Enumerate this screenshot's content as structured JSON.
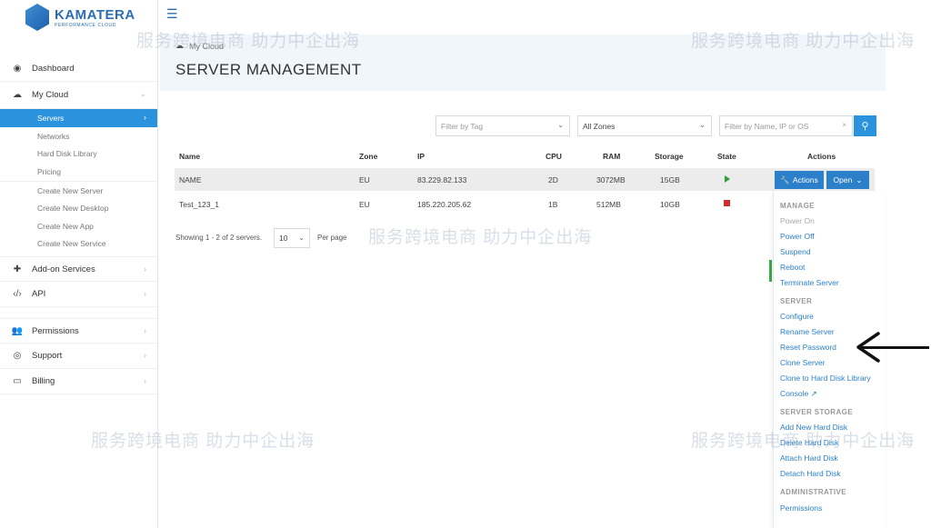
{
  "brand": {
    "name": "KAMATERA",
    "tagline": "PERFORMANCE CLOUD"
  },
  "sidebar": {
    "items": [
      {
        "label": "Dashboard",
        "icon": "dashboard-icon"
      },
      {
        "label": "My Cloud",
        "icon": "cloud-icon"
      }
    ],
    "subitems": [
      {
        "label": "Servers",
        "active": true
      },
      {
        "label": "Networks"
      },
      {
        "label": "Hard Disk Library"
      },
      {
        "label": "Pricing"
      },
      {
        "label": "Create New Server"
      },
      {
        "label": "Create New Desktop"
      },
      {
        "label": "Create New App"
      },
      {
        "label": "Create New Service"
      }
    ],
    "lower": [
      {
        "label": "Add-on Services",
        "icon": "puzzle-icon"
      },
      {
        "label": "API",
        "icon": "code-icon"
      },
      {
        "label": "Permissions",
        "icon": "users-icon"
      },
      {
        "label": "Support",
        "icon": "support-icon"
      },
      {
        "label": "Billing",
        "icon": "card-icon"
      }
    ]
  },
  "header": {
    "breadcrumb": "My Cloud",
    "title": "SERVER MANAGEMENT"
  },
  "filters": {
    "tag_placeholder": "Filter by Tag",
    "zone_value": "All Zones",
    "search_placeholder": "Filter by Name, IP or OS"
  },
  "table": {
    "columns": [
      "Name",
      "Zone",
      "IP",
      "CPU",
      "RAM",
      "Storage",
      "State",
      "Actions"
    ],
    "rows": [
      {
        "name": "NAME",
        "zone": "EU",
        "ip": "83.229.82.133",
        "cpu": "2D",
        "ram": "3072MB",
        "storage": "15GB",
        "state": "running"
      },
      {
        "name": "Test_123_1",
        "zone": "EU",
        "ip": "185.220.205.62",
        "cpu": "1B",
        "ram": "512MB",
        "storage": "10GB",
        "state": "stopped"
      }
    ],
    "actions_label": "Actions",
    "open_label": "Open"
  },
  "pager": {
    "showing": "Showing 1 - 2 of 2 servers.",
    "per_page_value": "10",
    "per_page_label": "Per page"
  },
  "menu": {
    "manage_header": "MANAGE",
    "power_on": "Power On",
    "power_off": "Power Off",
    "suspend": "Suspend",
    "reboot": "Reboot",
    "terminate": "Terminate Server",
    "server_header": "SERVER",
    "configure": "Configure",
    "rename": "Rename Server",
    "reset_password": "Reset Password",
    "clone": "Clone Server",
    "clone_hdl": "Clone to Hard Disk Library",
    "console": "Console",
    "storage_header": "SERVER STORAGE",
    "add_disk": "Add New Hard Disk",
    "delete_disk": "Delete Hard Disk",
    "attach_disk": "Attach Hard Disk",
    "detach_disk": "Detach Hard Disk",
    "admin_header": "ADMINISTRATIVE",
    "permissions": "Permissions"
  },
  "watermark": {
    "text": "服务跨境电商 助力中企出海"
  },
  "colors": {
    "accent": "#2b93dd",
    "button": "#2b80c9",
    "running": "#2e9e3b",
    "stopped": "#d22c2c"
  }
}
